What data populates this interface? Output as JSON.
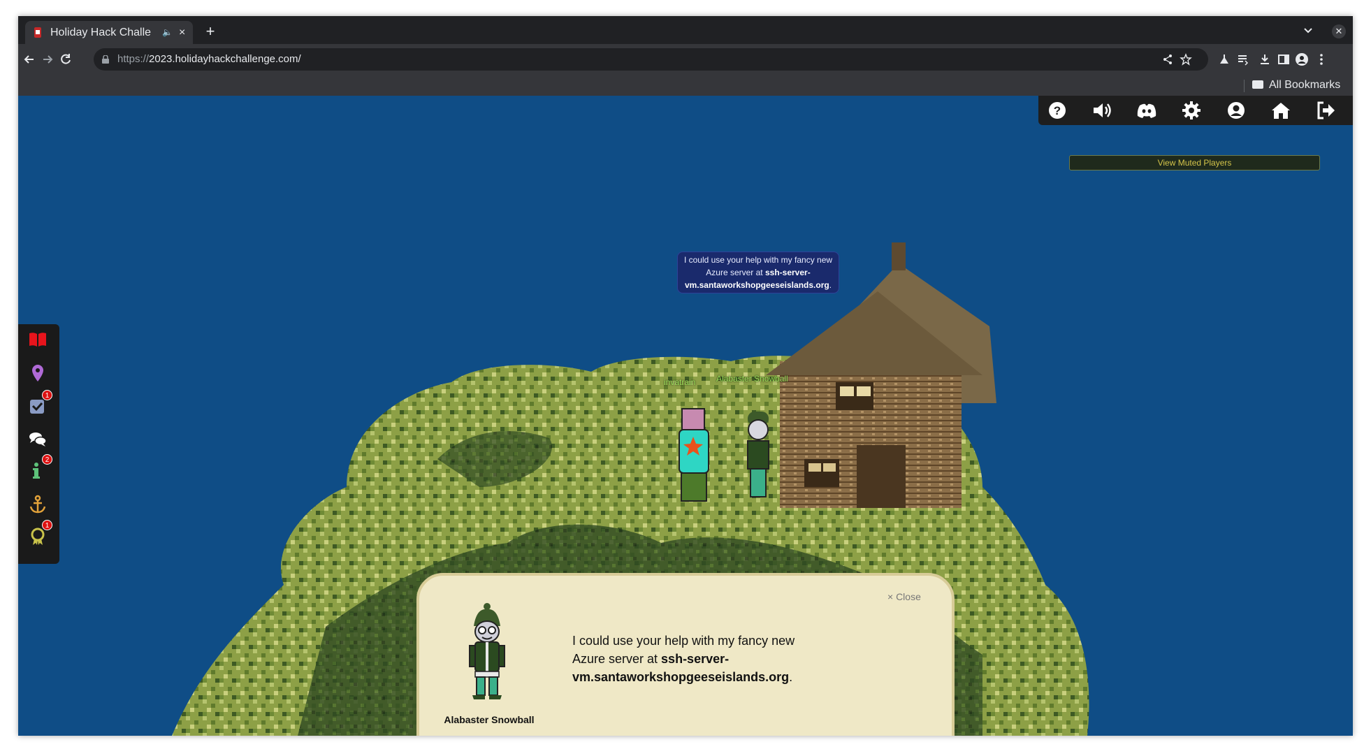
{
  "browser": {
    "tab_title": "Holiday Hack Challe",
    "tab_audio_icon": "speaker-icon",
    "tab_close": "×",
    "new_tab": "+",
    "url_scheme": "https://",
    "url_host": "2023.holidayhackchallenge.com/",
    "bookmarks_folder": "All Bookmarks"
  },
  "game": {
    "top_menu": [
      "help-icon",
      "volume-icon",
      "discord-icon",
      "settings-icon",
      "profile-icon",
      "home-icon",
      "logout-icon"
    ],
    "muted_players_label": "View Muted Players",
    "sidebar": [
      {
        "icon": "book-icon",
        "badge": ""
      },
      {
        "icon": "map-pin-icon",
        "badge": ""
      },
      {
        "icon": "objectives-checkbox-icon",
        "badge": "1"
      },
      {
        "icon": "chat-icon",
        "badge": ""
      },
      {
        "icon": "info-icon",
        "badge": "2"
      },
      {
        "icon": "anchor-icon",
        "badge": ""
      },
      {
        "icon": "achievement-icon",
        "badge": "1"
      }
    ],
    "speech_bubble": {
      "text_pre": "I could use your help with my fancy new Azure server at ",
      "text_bold": "ssh-server-vm.santaworkshopgeeseislands.org",
      "text_post": "."
    },
    "player_name": "invatrain",
    "npc_name": "Alabaster Snowball",
    "dialog": {
      "close_label": "× Close",
      "speaker": "Alabaster Snowball",
      "text_pre": "I could use your help with my fancy new Azure server at ",
      "text_bold": "ssh-server-vm.santaworkshopgeeseislands.org",
      "text_post": "."
    }
  },
  "colors": {
    "sky": "#0f4d86",
    "dialog_bg": "#efe8c6",
    "name_tag": "#9be05a",
    "badge": "#dd1111"
  }
}
